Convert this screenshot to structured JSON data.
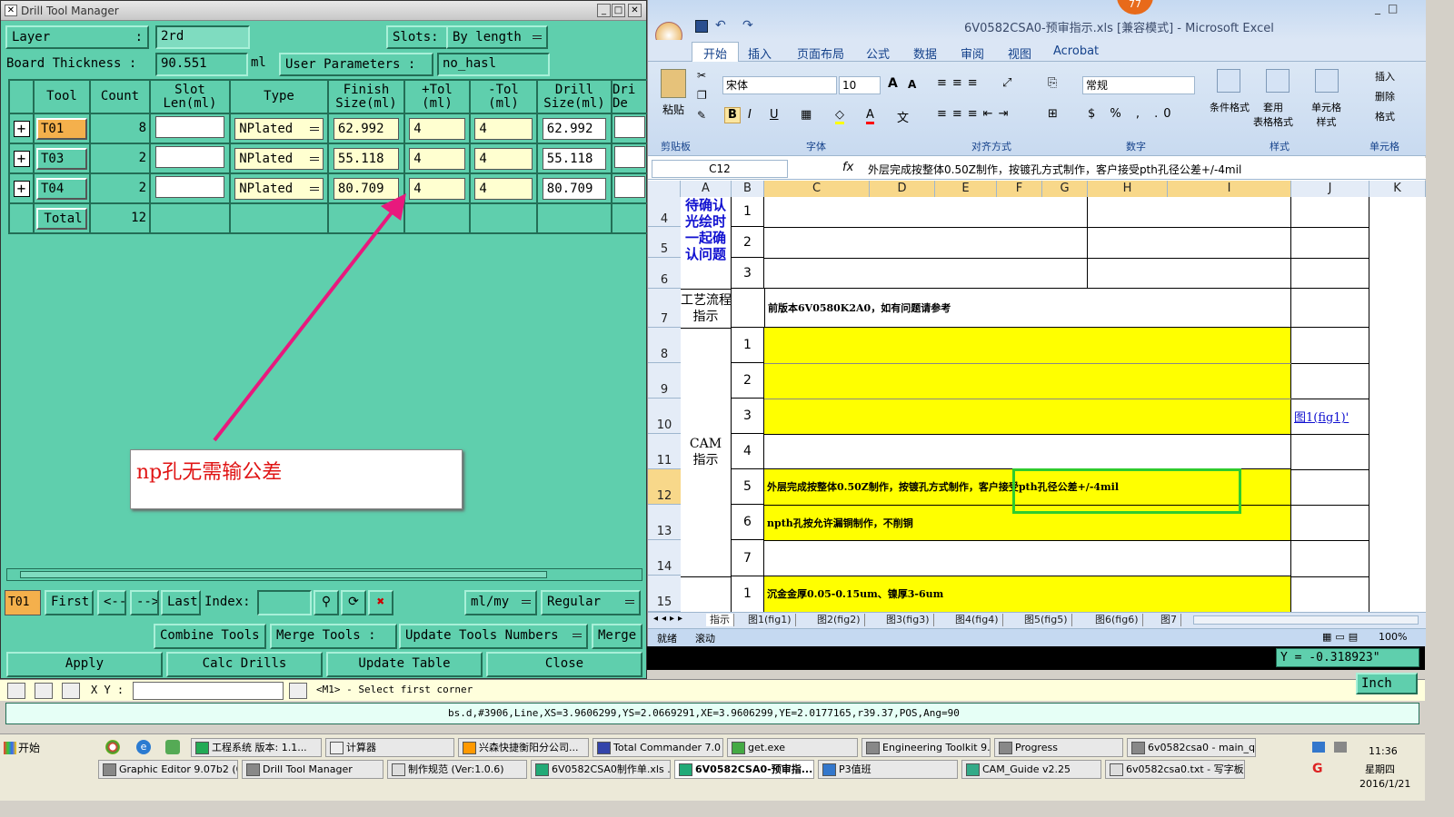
{
  "dtm": {
    "title": "Drill Tool Manager",
    "win_buttons": [
      "_",
      "□",
      "✕"
    ],
    "layer_label": "Layer",
    "layer_colon": ":",
    "layer_value": "2rd",
    "slots_label": "Slots:",
    "slots_value": "By length",
    "board_label": "Board Thickness :",
    "board_value": "90.551",
    "board_unit": "ml",
    "user_params_label": "User Parameters :",
    "user_params_value": "no_hasl",
    "headers": [
      "Tool",
      "Count",
      "Slot\nLen(ml)",
      "Type",
      "Finish\nSize(ml)",
      "+Tol\n(ml)",
      "-Tol\n(ml)",
      "Drill\nSize(ml)",
      "Dri\nDe"
    ],
    "rows": [
      {
        "tool": "T01",
        "count": "8",
        "slot": "",
        "type": "NPlated",
        "finish": "62.992",
        "ptol": "4",
        "ntol": "4",
        "drill": "62.992"
      },
      {
        "tool": "T03",
        "count": "2",
        "slot": "",
        "type": "NPlated",
        "finish": "55.118",
        "ptol": "4",
        "ntol": "4",
        "drill": "55.118"
      },
      {
        "tool": "T04",
        "count": "2",
        "slot": "",
        "type": "NPlated",
        "finish": "80.709",
        "ptol": "4",
        "ntol": "4",
        "drill": "80.709"
      }
    ],
    "total_label": "Total",
    "total_count": "12",
    "annotation": "np孔无需输公差",
    "nav": {
      "current": "T01",
      "first": "First",
      "prev": "<--",
      "next": "-->",
      "last": "Last",
      "index_label": "Index:",
      "unit": "ml/my",
      "mode": "Regular"
    },
    "actions": {
      "combine": "Combine Tools",
      "merge_tools": "Merge Tools :",
      "update_numbers": "Update Tools Numbers",
      "merge": "Merge",
      "apply": "Apply",
      "calc": "Calc Drills",
      "update_table": "Update Table",
      "close": "Close"
    }
  },
  "editor": {
    "xy_label": "X Y :",
    "prompt": "<M1> - Select first corner",
    "y_readout": "Y = -0.318923\"",
    "unit": "Inch",
    "status": "bs.d,#3906,Line,XS=3.9606299,YS=2.0669291,XE=3.9606299,YE=2.0177165,r39.37,POS,Ang=90"
  },
  "excel": {
    "title": "6V0582CSA0-预审指示.xls  [兼容模式] - Microsoft Excel",
    "badge": "77",
    "tabs": [
      "开始",
      "插入",
      "页面布局",
      "公式",
      "数据",
      "审阅",
      "视图",
      "Acrobat"
    ],
    "font_name": "宋体",
    "font_size": "10",
    "number_format": "常规",
    "groups": [
      "剪贴板",
      "字体",
      "对齐方式",
      "数字",
      "样式",
      "单元格"
    ],
    "paste": "粘贴",
    "styles_btns": [
      "条件格式",
      "套用\n表格格式",
      "单元格\n样式"
    ],
    "cell_btns": [
      "插入",
      "删除",
      "格式"
    ],
    "name_box": "C12",
    "fx": "fx",
    "formula": "外层完成按整体0.50Z制作，按镀孔方式制作，客户接受pth孔径公差+/-4mil",
    "columns": [
      "A",
      "B",
      "C",
      "D",
      "E",
      "F",
      "G",
      "H",
      "I",
      "J",
      "K"
    ],
    "rows": [
      "4",
      "5",
      "6",
      "7",
      "8",
      "9",
      "10",
      "11",
      "12",
      "13",
      "14",
      "15"
    ],
    "a_pending": "待确认\n光绘时\n一起确\n认问题",
    "a_process": "工艺流程\n指示",
    "a_cam": "CAM\n指示",
    "b_nums": [
      "1",
      "2",
      "3",
      "1",
      "2",
      "3",
      "4",
      "5",
      "6",
      "7",
      "1"
    ],
    "c7": "前版本6V0580K2A0，如有问题请参考",
    "j10": "图1(fig1)'",
    "c12": "外层完成按整体0.50Z制作，按镀孔方式制作，客户接受pth孔径公差+/-4mil",
    "c13": "npth孔按允许漏铜制作，不削铜",
    "c15": "沉金金厚0.05-0.15um、镍厚3-6um",
    "sheets": [
      "指示",
      "图1(fig1)",
      "图2(fig2)",
      "图3(fig3)",
      "图4(fig4)",
      "图5(fig5)",
      "图6(fig6)",
      "图7"
    ],
    "status_left": "就绪",
    "status_mid": "滚动",
    "zoom": "100%"
  },
  "taskbar": {
    "start": "开始",
    "row1": [
      "工程系统  版本: 1.1...",
      "计算器",
      "兴森快捷衡阳分公司...",
      "Total Commander 7.0 ...",
      "get.exe",
      "Engineering Toolkit 9....",
      "Progress",
      "6v0582csa0 - main_qa"
    ],
    "row2": [
      "Graphic Editor 9.07b2 (0...",
      "Drill Tool Manager",
      "制作规范 (Ver:1.0.6)",
      "6V0582CSA0制作单.xls ...",
      "6V0582CSA0-预审指...",
      "P3值班",
      "CAM_Guide v2.25",
      "6v0582csa0.txt - 写字板"
    ],
    "time": "11:36",
    "weekday": "星期四",
    "date": "2016/1/21"
  },
  "colors": {
    "dtm_bg": "#5fcfad",
    "tool_highlight": "#f4b04c",
    "arrow": "#e8197d",
    "excel_yellow": "#ffff00",
    "highlight_box": "#2ecc2e",
    "annotation_text": "#e01414"
  }
}
